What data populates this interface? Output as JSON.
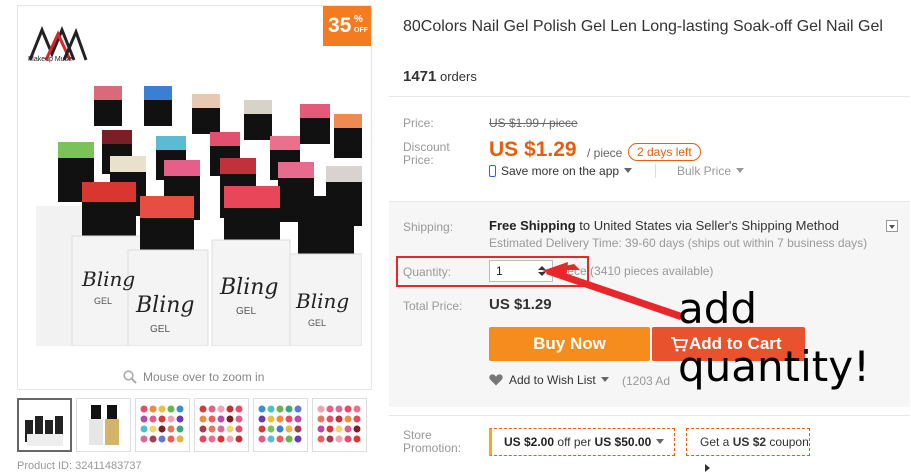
{
  "product": {
    "title": "80Colors Nail Gel Polish Gel Len Long-lasting Soak-off Gel Nail Gel",
    "orders_count": "1471",
    "orders_label": "orders",
    "product_id": "Product ID: 32411483737",
    "discount_number": "35",
    "discount_percent": "%",
    "discount_off": "OFF",
    "brand_name": "Makeup Muse",
    "zoom_hint": "Mouse over to zoom in"
  },
  "pricing": {
    "price_label": "Price:",
    "old_price": "US $1.99 / piece",
    "discount_label_1": "Discount",
    "discount_label_2": "Price:",
    "current_price": "US $1.29",
    "per_piece": "/ piece",
    "days_left": "2 days left",
    "app_save": "Save more on the app",
    "bulk_price": "Bulk Price"
  },
  "shipping": {
    "label": "Shipping:",
    "method_bold": "Free Shipping",
    "method_rest": "to United States via Seller's Shipping Method",
    "estimate": "Estimated Delivery Time: 39-60 days (ships out within 7 business days)"
  },
  "quantity": {
    "label": "Quantity:",
    "value": "1",
    "available": "piece (3410 pieces available)"
  },
  "total": {
    "label": "Total Price:",
    "value": "US $1.29"
  },
  "actions": {
    "buy_now": "Buy Now",
    "add_to_cart": "Add to Cart",
    "wish_list": "Add to Wish List",
    "wish_count": "(1203 Ad"
  },
  "annotation": {
    "line1": "add",
    "line2": "quantity!"
  },
  "store": {
    "label_1": "Store",
    "label_2": "Promotion:",
    "coupon1_prefix": "US $2.00",
    "coupon1_mid": "off per",
    "coupon1_suffix": "US $50.00",
    "coupon2_prefix": "Get a",
    "coupon2_bold": "US $2",
    "coupon2_suffix": "coupon"
  },
  "colors": {
    "accent_orange": "#e85d0c",
    "buy_now": "#f58d1e",
    "add_to_cart": "#e8522d",
    "highlight_red": "#e8272b"
  }
}
